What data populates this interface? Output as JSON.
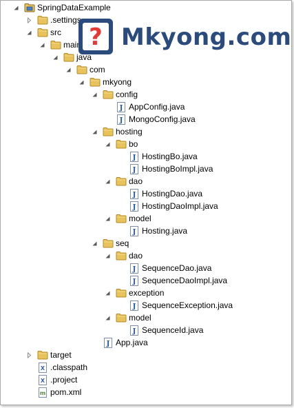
{
  "logo": {
    "text": "Mkyong.com",
    "icon": "question-badge-icon",
    "color": "#2a4b7c",
    "accent": "#e53935"
  },
  "tree": [
    {
      "label": "SpringDataExample",
      "depth": 0,
      "icon": "project",
      "twisty": "expanded"
    },
    {
      "label": ".settings",
      "depth": 1,
      "icon": "folder",
      "twisty": "collapsed"
    },
    {
      "label": "src",
      "depth": 1,
      "icon": "folder",
      "twisty": "expanded"
    },
    {
      "label": "main",
      "depth": 2,
      "icon": "folder",
      "twisty": "expanded"
    },
    {
      "label": "java",
      "depth": 3,
      "icon": "folder",
      "twisty": "expanded"
    },
    {
      "label": "com",
      "depth": 4,
      "icon": "folder",
      "twisty": "expanded"
    },
    {
      "label": "mkyong",
      "depth": 5,
      "icon": "folder",
      "twisty": "expanded"
    },
    {
      "label": "config",
      "depth": 6,
      "icon": "folder",
      "twisty": "expanded"
    },
    {
      "label": "AppConfig.java",
      "depth": 7,
      "icon": "java",
      "twisty": "none"
    },
    {
      "label": "MongoConfig.java",
      "depth": 7,
      "icon": "java",
      "twisty": "none"
    },
    {
      "label": "hosting",
      "depth": 6,
      "icon": "folder",
      "twisty": "expanded"
    },
    {
      "label": "bo",
      "depth": 7,
      "icon": "folder",
      "twisty": "expanded"
    },
    {
      "label": "HostingBo.java",
      "depth": 8,
      "icon": "java",
      "twisty": "none"
    },
    {
      "label": "HostingBoImpl.java",
      "depth": 8,
      "icon": "java",
      "twisty": "none"
    },
    {
      "label": "dao",
      "depth": 7,
      "icon": "folder",
      "twisty": "expanded"
    },
    {
      "label": "HostingDao.java",
      "depth": 8,
      "icon": "java",
      "twisty": "none"
    },
    {
      "label": "HostingDaoImpl.java",
      "depth": 8,
      "icon": "java",
      "twisty": "none"
    },
    {
      "label": "model",
      "depth": 7,
      "icon": "folder",
      "twisty": "expanded"
    },
    {
      "label": "Hosting.java",
      "depth": 8,
      "icon": "java",
      "twisty": "none"
    },
    {
      "label": "seq",
      "depth": 6,
      "icon": "folder",
      "twisty": "expanded"
    },
    {
      "label": "dao",
      "depth": 7,
      "icon": "folder",
      "twisty": "expanded"
    },
    {
      "label": "SequenceDao.java",
      "depth": 8,
      "icon": "java",
      "twisty": "none"
    },
    {
      "label": "SequenceDaoImpl.java",
      "depth": 8,
      "icon": "java",
      "twisty": "none"
    },
    {
      "label": "exception",
      "depth": 7,
      "icon": "folder",
      "twisty": "expanded"
    },
    {
      "label": "SequenceException.java",
      "depth": 8,
      "icon": "java",
      "twisty": "none"
    },
    {
      "label": "model",
      "depth": 7,
      "icon": "folder",
      "twisty": "expanded"
    },
    {
      "label": "SequenceId.java",
      "depth": 8,
      "icon": "java",
      "twisty": "none"
    },
    {
      "label": "App.java",
      "depth": 6,
      "icon": "java",
      "twisty": "none"
    },
    {
      "label": "target",
      "depth": 1,
      "icon": "folder",
      "twisty": "collapsed"
    },
    {
      "label": ".classpath",
      "depth": 1,
      "icon": "xml",
      "twisty": "none"
    },
    {
      "label": ".project",
      "depth": 1,
      "icon": "xml",
      "twisty": "none"
    },
    {
      "label": "pom.xml",
      "depth": 1,
      "icon": "pom",
      "twisty": "none"
    }
  ]
}
